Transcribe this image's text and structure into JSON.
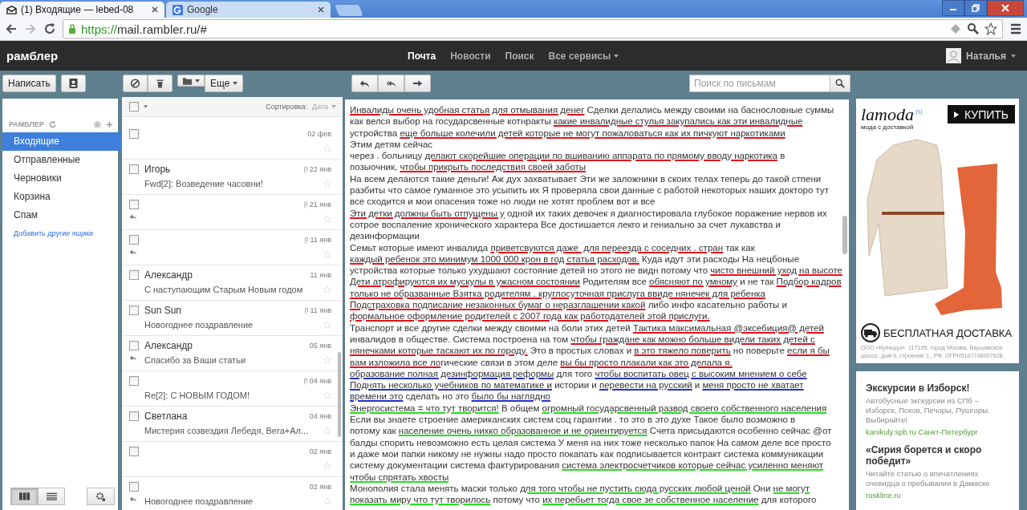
{
  "browser": {
    "tabs": [
      {
        "title": "(1) Входящие — lebed-08",
        "selected": true
      },
      {
        "title": "Google",
        "selected": false
      }
    ],
    "url": {
      "scheme": "https://",
      "rest": "mail.rambler.ru/#"
    }
  },
  "header": {
    "logo": "рамблер",
    "nav": [
      {
        "label": "Почта",
        "selected": true,
        "kind": "link"
      },
      {
        "label": "Новости",
        "selected": false,
        "kind": "link"
      },
      {
        "label": "Поиск",
        "selected": false,
        "kind": "link"
      },
      {
        "label": "Все сервисы",
        "selected": false,
        "kind": "menu"
      }
    ],
    "user": "Наталья"
  },
  "toolbar": {
    "compose": "Написать",
    "more": "Еще",
    "search_placeholder": "Поиск по письмам"
  },
  "sidebar": {
    "account": "РАМБЛЕР",
    "folders": [
      {
        "label": "Входящие",
        "selected": true
      },
      {
        "label": "Отправленные",
        "selected": false
      },
      {
        "label": "Черновики",
        "selected": false
      },
      {
        "label": "Корзина",
        "selected": false
      },
      {
        "label": "Спам",
        "selected": false
      }
    ],
    "add_link": "Добавить другие ящики",
    "views": [
      {
        "kind": "columns",
        "selected": true
      },
      {
        "kind": "list",
        "selected": false
      }
    ]
  },
  "message_list": {
    "select_all_checked": false,
    "sort_label": "Сортировка:",
    "sort_value": "Дата",
    "rows": [
      {
        "date": "02 фев",
        "attachment": false,
        "replied": false,
        "checked": false,
        "starred": false
      },
      {
        "sender": "Игорь",
        "subject": "Fwd[2]: Возведение часовни!",
        "date": "22 янв",
        "attachment": true,
        "replied": false,
        "checked": false,
        "starred": false
      },
      {
        "date": "21 янв",
        "attachment": true,
        "replied": true,
        "checked": false,
        "starred": false
      },
      {
        "date": "11 янв",
        "attachment": true,
        "replied": true,
        "checked": false,
        "starred": false
      },
      {
        "sender": "Александр",
        "subject": "С наступающим Старым Новым годом",
        "date": "11 янв",
        "attachment": false,
        "replied": false,
        "checked": false,
        "starred": false
      },
      {
        "sender": "Sun Sun",
        "subject": "Новогоднее поздравление",
        "date": "11 янв",
        "attachment": true,
        "replied": false,
        "checked": false,
        "starred": false
      },
      {
        "sender": "Александр",
        "subject": "Спасибо за Ваши статьи",
        "date": "05 янв",
        "attachment": false,
        "replied": true,
        "checked": false,
        "starred": false
      },
      {
        "subject": "Re[2]: С НОВЫМ ГОДОМ!",
        "date": "04 янв",
        "attachment": true,
        "replied": false,
        "checked": false,
        "starred": false
      },
      {
        "sender": "Светлана",
        "subject": "Мистерия созвездия Лебедя, Вега+Ал...",
        "date": "04 янв",
        "attachment": false,
        "replied": false,
        "checked": false,
        "starred": false
      },
      {
        "date": "02 янв",
        "attachment": false,
        "replied": false,
        "checked": false,
        "starred": false
      },
      {
        "subject": "Новогоднее поздравление",
        "date": "02 янв",
        "attachment": false,
        "replied": true,
        "checked": false,
        "starred": false
      }
    ]
  },
  "message": {
    "lines": [
      {
        "segments": [
          {
            "text": "Инвалиды очень удобная статья для отмывания денег",
            "color": "#e8101c"
          },
          {
            "text": " Сделки делались между своими на баснословные суммы"
          }
        ]
      },
      {
        "segments": [
          {
            "text": "как велся выбор на государсвенные котнракты "
          },
          {
            "text": "какие инвалидные стулья закупались как эти инвалидные",
            "color": "#e8101c"
          }
        ]
      },
      {
        "segments": [
          {
            "text": "устройства "
          },
          {
            "text": "еще больше колечили детей которые",
            "color": "#e8101c"
          },
          {
            "text": " не могут пожаловаться как их пичкуют наркотиками",
            "color": "#e8101c"
          }
        ]
      },
      {
        "segments": [
          {
            "text": "Этим детям сейчас"
          }
        ]
      },
      {
        "segments": [
          {
            "text": "через . больницу "
          },
          {
            "text": "делают скорейшие операции по вшиванию аппарата по прямому вводу наркотика",
            "color": "#e8101c"
          },
          {
            "text": " в"
          }
        ]
      },
      {
        "segments": [
          {
            "text": "позыочник, "
          },
          {
            "text": "чтобы прикрыть последствия своей заботы",
            "color": "#e8101c"
          }
        ]
      },
      {
        "segments": [
          {
            "text": "На всем делаются такие деньги! Аж дух захватывает Эти же заложники в скоих телах теперь до такой стпени"
          }
        ]
      },
      {
        "segments": [
          {
            "text": "разбиты что самое гуманное это усыпить их Я проверяла свои данные с работой некоторых наших докторо тут"
          }
        ]
      },
      {
        "segments": [
          {
            "text": "все сходится и мои опасения тоже но люди не хотят проблем вот и все"
          }
        ]
      },
      {
        "segments": [
          {
            "text": "Эти детки должны быть отпущены у",
            "color": "#e8101c"
          },
          {
            "text": " одной их таких девочек я диагностировала глубокое поражение нервов их"
          }
        ]
      },
      {
        "segments": [
          {
            "text": "сотрое воспаление хронического характера Все достишается лекго и гениально за счет лукавства и"
          }
        ]
      },
      {
        "segments": [
          {
            "text": "дезинформации"
          }
        ]
      },
      {
        "segments": [
          {
            "text": "Семьт которые имеют инвалида "
          },
          {
            "text": "приветсвуются даже  для переезда с соседних . стран",
            "color": "#e8101c"
          },
          {
            "text": " так как"
          }
        ]
      },
      {
        "segments": [
          {
            "text": "каждый ребенок это минимум 1000 000 крон в год статья расходов.",
            "color": "#e8101c"
          },
          {
            "text": " Куда идут эти расходы На нецбоные"
          }
        ]
      },
      {
        "segments": [
          {
            "text": "устройства которые только ухудшают состояние детей но этого не видн потому что "
          },
          {
            "text": "чисто внешний уход на высоте",
            "color": "#e8101c"
          }
        ]
      },
      {
        "segments": [
          {
            "text": "Дети атрофируются их мускулы в ужасном состоянии",
            "color": "#e8101c"
          },
          {
            "text": " Родителям все "
          },
          {
            "text": "обясняют по умному",
            "color": "#e8101c"
          },
          {
            "text": " и не так "
          },
          {
            "text": "Подбор кадров",
            "color": "#e8101c"
          }
        ]
      },
      {
        "segments": [
          {
            "text": "только не образванные",
            "color": "#e8101c"
          },
          {
            "text": " Взятка родителям . круглосуточная прислуга ввиде нянечек для ребенка",
            "color": "#e8101c"
          }
        ]
      },
      {
        "segments": [
          {
            "text": "Подстраховка подписание незаконных бумаг о неразглашении какой",
            "color": "#e8101c"
          },
          {
            "text": " либо инфо касательно работы и"
          }
        ]
      },
      {
        "segments": [
          {
            "text": "формальное оформление родителей с 2007 года как работодателей этой прислуги.",
            "color": "#e8101c"
          }
        ]
      },
      {
        "segments": [
          {
            "text": "Транспорт и все другие сделки между своими на боли этих детей "
          },
          {
            "text": "Тактика максимальная @эксебиция@ детей",
            "color": "#e8101c"
          }
        ]
      },
      {
        "segments": [
          {
            "text": "инвалидов в обществе. Система построена на том "
          },
          {
            "text": "чтобы граждане как можно больше видели таких детей с",
            "color": "#e8101c"
          }
        ]
      },
      {
        "segments": [
          {
            "text": "нянечками которые таскают их по городу.",
            "color": "#e8101c"
          },
          {
            "text": " Это в простых словах и "
          },
          {
            "text": "в это тяжело поверить",
            "color": "#e8101c"
          },
          {
            "text": " но поверьте "
          },
          {
            "text": "если я бы",
            "color": "#e8101c"
          }
        ]
      },
      {
        "segments": [
          {
            "text": "вам изложила все ло",
            "color": "#e8101c"
          },
          {
            "text": "гические связи в этом деле "
          },
          {
            "text": "вы бы просто плакали как это делала я.",
            "color": "#e8101c"
          }
        ]
      },
      {
        "segments": [
          {
            "text": "образование полная дезинформация реформы",
            "color": "#2431c8"
          },
          {
            "text": " для того "
          },
          {
            "text": "чтобы воспитать овец с высоким мнением о себе",
            "color": "#2431c8"
          }
        ]
      },
      {
        "segments": [
          {
            "text": "Поднять несколько учебников по математике и",
            "color": "#2431c8"
          },
          {
            "text": " истории и "
          },
          {
            "text": "перевести на русский",
            "color": "#2431c8"
          },
          {
            "text": " и "
          },
          {
            "text": "меня просто не хватает",
            "color": "#2431c8"
          }
        ]
      },
      {
        "segments": [
          {
            "text": "времени это",
            "color": "#2431c8"
          },
          {
            "text": " сделать но это "
          },
          {
            "text": "было бы наглядно",
            "color": "#2431c8"
          }
        ]
      },
      {
        "segments": [
          {
            "text": "Энергосистема = что тут творится!",
            "color": "#22e01c"
          },
          {
            "text": " В общем "
          },
          {
            "text": "огромный государсвенный развод своего собственного населения",
            "color": "#22e01c"
          }
        ]
      },
      {
        "segments": [
          {
            "text": "Если вы знаете строение американских систем соц гарантии . то это в это духе Такое было возможно в"
          }
        ]
      },
      {
        "segments": [
          {
            "text": "потому как "
          },
          {
            "text": "население очень нихко образованное и не ориентируется",
            "color": "#22e01c"
          },
          {
            "text": " Счета присыдаются особенно сейчас @от"
          }
        ]
      },
      {
        "segments": [
          {
            "text": "балды спорить невозможно есть целая система У меня на них тоже несколько папок На самом деле все просто"
          }
        ]
      },
      {
        "segments": [
          {
            "text": "и даже мои папки никому не нужны надо просто покапать как подписывается контракт система коммуникации"
          }
        ]
      },
      {
        "segments": [
          {
            "text": "систему документации система фактурирования "
          },
          {
            "text": "система электросчетчиков которые сейчас усиленно меняют",
            "color": "#22e01c"
          }
        ]
      },
      {
        "segments": [
          {
            "text": "чтобы спрятать хвосты",
            "color": "#22e01c"
          }
        ]
      },
      {
        "segments": [
          {
            "text": "Монополия стала менять маски только "
          },
          {
            "text": "для того чтобы не пустить сюда русских любой ценой",
            "color": "#22e01c"
          },
          {
            "text": " Они "
          },
          {
            "text": "не могут",
            "color": "#22e01c"
          }
        ]
      },
      {
        "segments": [
          {
            "text": "показать миру что тут творилось",
            "color": "#22e01c"
          },
          {
            "text": " потому что "
          },
          {
            "text": "их перебьет тогда свое зе собственное население",
            "color": "#22e01c"
          },
          {
            "text": " для которого"
          }
        ]
      }
    ]
  },
  "ads": [
    {
      "kind": "banner",
      "brand": "lamoda",
      "brand_suffix": ".ru",
      "tagline": "мода с доставкой",
      "button": "КУПИТЬ",
      "headline": "БЕСПЛАТНАЯ ДОСТАВКА",
      "legal": "ООО «Купишуз». 117105, город Москва, Варшавское шоссе, дом 9, строение 1., РФ. ОГРН5107746007628."
    },
    {
      "kind": "text",
      "items": [
        {
          "title": "Экскурсии в Изборск!",
          "text": "Автобусные экскурсии из СПб – Изборск, Псков, Печоры, Пушгоры. Выбирайте!",
          "link": "kanikuly.spb.ru Санкт-Петербург"
        },
        {
          "title": "«Сирия борется и скоро победит»",
          "text": "Читайте статью о впечатлениях очевидца о пребывании в Дамаске",
          "link": "ruskline.ru"
        }
      ]
    }
  ]
}
